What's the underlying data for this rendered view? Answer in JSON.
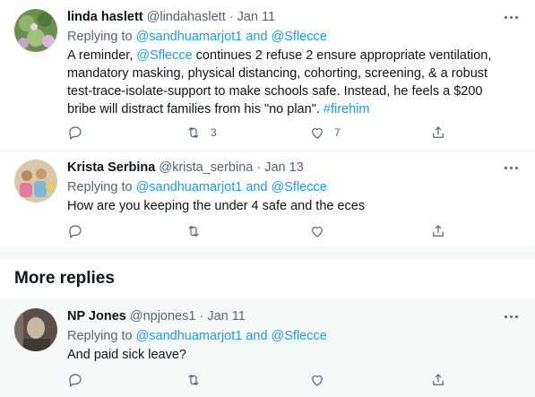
{
  "tweets": [
    {
      "name": "linda haslett",
      "handle": "@lindahaslett",
      "date": "Jan 11",
      "replying_prefix": "Replying to ",
      "replying_users": "@sandhuamarjot1 and @Sflecce",
      "body_parts": {
        "p1": "A reminder, ",
        "mention": "@Sflecce",
        "p2": " continues 2 refuse 2 ensure appropriate ventilation, mandatory masking, physical distancing, cohorting, screening, & a robust test-trace-isolate-support to make schools safe. Instead, he feels a $200 bribe will distract families from his \"no plan\". ",
        "hashtag": "#firehim"
      },
      "retweets": "3",
      "likes": "7"
    },
    {
      "name": "Krista Serbina",
      "handle": "@krista_serbina",
      "date": "Jan 13",
      "replying_prefix": "Replying to ",
      "replying_users": "@sandhuamarjot1 and @Sflecce",
      "body": "How are you keeping the under 4 safe and the eces"
    },
    {
      "name": "NP Jones",
      "handle": "@npjones1",
      "date": "Jan 11",
      "replying_prefix": "Replying to ",
      "replying_users": "@sandhuamarjot1 and @Sflecce",
      "body": "And paid sick leave?"
    }
  ],
  "section": {
    "more_replies": "More replies"
  },
  "separator": " · ",
  "icons": [
    "reply-icon",
    "retweet-icon",
    "like-icon",
    "share-icon",
    "more-icon"
  ],
  "colors": {
    "link": "#1d9bf0",
    "muted": "#536471",
    "text": "#0f1419"
  }
}
